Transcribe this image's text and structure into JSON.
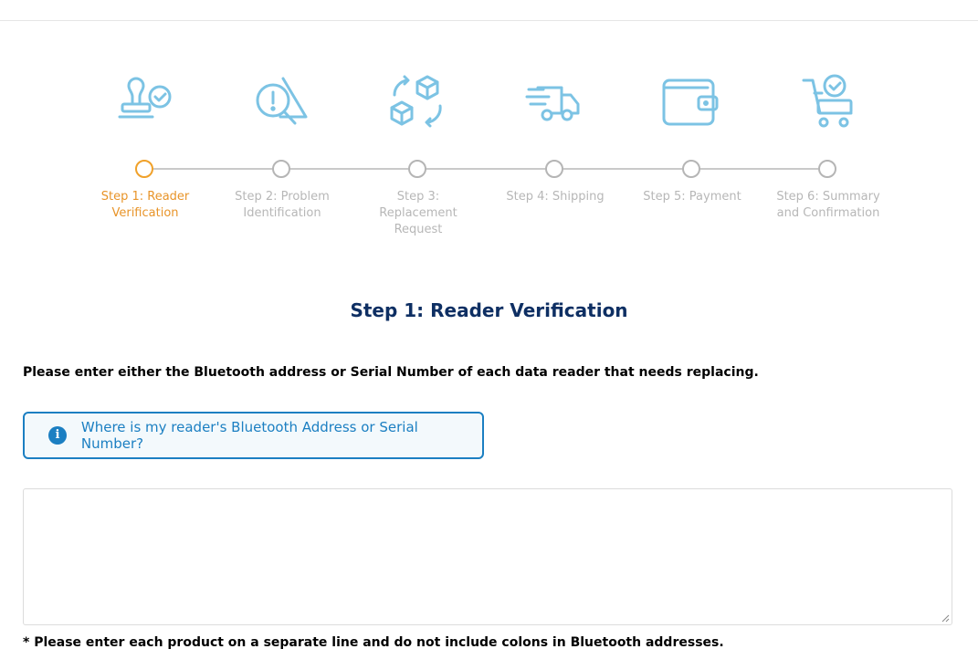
{
  "stepper": {
    "steps": [
      {
        "label_line1": "Step 1: Reader",
        "label_line2": "Verification",
        "label_line3": "",
        "icon": "stamp-check-icon",
        "active": true
      },
      {
        "label_line1": "Step 2: Problem",
        "label_line2": "Identification",
        "label_line3": "",
        "icon": "warning-search-icon",
        "active": false
      },
      {
        "label_line1": "Step 3:",
        "label_line2": "Replacement",
        "label_line3": "Request",
        "icon": "replace-boxes-icon",
        "active": false
      },
      {
        "label_line1": "Step 4: Shipping",
        "label_line2": "",
        "label_line3": "",
        "icon": "delivery-truck-icon",
        "active": false
      },
      {
        "label_line1": "Step 5: Payment",
        "label_line2": "",
        "label_line3": "",
        "icon": "wallet-icon",
        "active": false
      },
      {
        "label_line1": "Step 6: Summary",
        "label_line2": "and Confirmation",
        "label_line3": "",
        "icon": "cart-check-icon",
        "active": false
      }
    ],
    "active_color": "#e89429",
    "inactive_color": "#b7b7b7",
    "icon_color": "#7cc3e4"
  },
  "main": {
    "title": "Step 1: Reader Verification",
    "instruction": "Please enter either the Bluetooth address or Serial Number of each data reader that needs replacing.",
    "info_link": "Where is my reader's Bluetooth Address or Serial Number?",
    "textarea_value": "",
    "footnote": "* Please enter each product on a separate line and do not include colons in Bluetooth addresses."
  },
  "colors": {
    "title": "#0e2f63",
    "accent": "#1b7fc2"
  }
}
